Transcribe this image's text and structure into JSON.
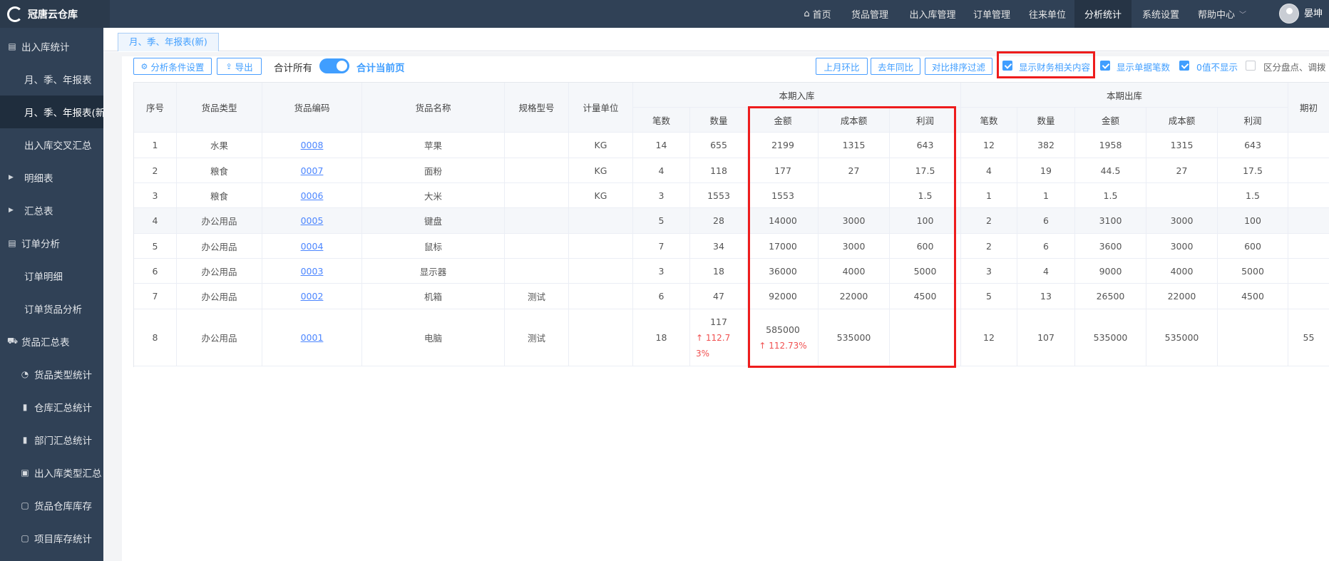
{
  "app": {
    "name": "冠唐云仓库",
    "user": "晏坤"
  },
  "nav": {
    "items": [
      {
        "label": "首页",
        "icon": "home-icon"
      },
      {
        "label": "货品管理"
      },
      {
        "label": "出入库管理"
      },
      {
        "label": "订单管理"
      },
      {
        "label": "往来单位"
      },
      {
        "label": "分析统计",
        "active": true
      },
      {
        "label": "系统设置"
      },
      {
        "label": "帮助中心",
        "dropdown": true
      }
    ]
  },
  "sidebar": {
    "items": [
      {
        "label": "出入库统计",
        "icon": "document-icon"
      },
      {
        "label": "月、季、年报表"
      },
      {
        "label": "月、季、年报表(新)",
        "active": true
      },
      {
        "label": "出入库交叉汇总"
      },
      {
        "label": "明细表",
        "icon": "caret-right-icon"
      },
      {
        "label": "汇总表",
        "icon": "caret-right-icon"
      },
      {
        "label": "订单分析",
        "icon": "document-icon"
      },
      {
        "label": "订单明细"
      },
      {
        "label": "订单货品分析"
      },
      {
        "label": "货品汇总表",
        "icon": "cart-icon"
      },
      {
        "label": "货品类型统计",
        "icon": "pie-chart-icon"
      },
      {
        "label": "仓库汇总统计",
        "icon": "bar-chart-icon"
      },
      {
        "label": "部门汇总统计",
        "icon": "bar-chart-icon"
      },
      {
        "label": "出入库类型汇总",
        "icon": "chart-icon"
      },
      {
        "label": "货品仓库库存",
        "icon": "box-icon"
      },
      {
        "label": "项目库存统计",
        "icon": "box-icon"
      }
    ]
  },
  "tabs": [
    {
      "label": "月、季、年报表(新)",
      "active": true
    }
  ],
  "toolbar": {
    "analysis_settings": "分析条件设置",
    "export": "导出",
    "total_all": "合计所有",
    "total_page": "合计当前页",
    "total_toggle_on": true,
    "prev_month": "上月环比",
    "last_year": "去年同比",
    "sort_filter": "对比排序过滤",
    "show_finance": "显示财务相关内容",
    "show_finance_checked": true,
    "show_doc_count": "显示单据笔数",
    "show_doc_count_checked": true,
    "hide_zero": "0值不显示",
    "hide_zero_checked": true,
    "split_stock": "区分盘点、调拨",
    "split_stock_checked": false
  },
  "table": {
    "group_headers": {
      "in": "本期入库",
      "out": "本期出库",
      "opening": "期初"
    },
    "columns": {
      "seq": "序号",
      "type": "货品类型",
      "code": "货品编码",
      "name": "货品名称",
      "spec": "规格型号",
      "unit": "计量单位",
      "count": "笔数",
      "qty": "数量",
      "amount": "金额",
      "cost": "成本额",
      "profit": "利润"
    },
    "rows": [
      {
        "seq": "1",
        "type": "水果",
        "code": "0008",
        "name": "苹果",
        "spec": "",
        "unit": "KG",
        "in_count": "14",
        "in_qty": "655",
        "in_amount": "2199",
        "in_cost": "1315",
        "in_profit": "643",
        "out_count": "12",
        "out_qty": "382",
        "out_amount": "1958",
        "out_cost": "1315",
        "out_profit": "643",
        "opening": ""
      },
      {
        "seq": "2",
        "type": "粮食",
        "code": "0007",
        "name": "面粉",
        "spec": "",
        "unit": "KG",
        "in_count": "4",
        "in_qty": "118",
        "in_amount": "177",
        "in_cost": "27",
        "in_profit": "17.5",
        "out_count": "4",
        "out_qty": "19",
        "out_amount": "44.5",
        "out_cost": "27",
        "out_profit": "17.5",
        "opening": ""
      },
      {
        "seq": "3",
        "type": "粮食",
        "code": "0006",
        "name": "大米",
        "spec": "",
        "unit": "KG",
        "in_count": "3",
        "in_qty": "1553",
        "in_amount": "1553",
        "in_cost": "",
        "in_profit": "1.5",
        "out_count": "1",
        "out_qty": "1",
        "out_amount": "1.5",
        "out_cost": "",
        "out_profit": "1.5",
        "opening": ""
      },
      {
        "seq": "4",
        "type": "办公用品",
        "code": "0005",
        "name": "键盘",
        "spec": "",
        "unit": "",
        "in_count": "5",
        "in_qty": "28",
        "in_amount": "14000",
        "in_cost": "3000",
        "in_profit": "100",
        "out_count": "2",
        "out_qty": "6",
        "out_amount": "3100",
        "out_cost": "3000",
        "out_profit": "100",
        "opening": "",
        "highlight": true
      },
      {
        "seq": "5",
        "type": "办公用品",
        "code": "0004",
        "name": "鼠标",
        "spec": "",
        "unit": "",
        "in_count": "7",
        "in_qty": "34",
        "in_amount": "17000",
        "in_cost": "3000",
        "in_profit": "600",
        "out_count": "2",
        "out_qty": "6",
        "out_amount": "3600",
        "out_cost": "3000",
        "out_profit": "600",
        "opening": ""
      },
      {
        "seq": "6",
        "type": "办公用品",
        "code": "0003",
        "name": "显示器",
        "spec": "",
        "unit": "",
        "in_count": "3",
        "in_qty": "18",
        "in_amount": "36000",
        "in_cost": "4000",
        "in_profit": "5000",
        "out_count": "3",
        "out_qty": "4",
        "out_amount": "9000",
        "out_cost": "4000",
        "out_profit": "5000",
        "opening": ""
      },
      {
        "seq": "7",
        "type": "办公用品",
        "code": "0002",
        "name": "机箱",
        "spec": "测试",
        "unit": "",
        "in_count": "6",
        "in_qty": "47",
        "in_amount": "92000",
        "in_cost": "22000",
        "in_profit": "4500",
        "out_count": "5",
        "out_qty": "13",
        "out_amount": "26500",
        "out_cost": "22000",
        "out_profit": "4500",
        "opening": ""
      },
      {
        "seq": "8",
        "type": "办公用品",
        "code": "0001",
        "name": "电脑",
        "spec": "测试",
        "unit": "",
        "in_count": "18",
        "in_qty": "117",
        "in_qty_change": "↑ 112.73%",
        "in_amount": "585000",
        "in_amount_change": "↑ 112.73%",
        "in_cost": "535000",
        "in_profit": "",
        "out_count": "12",
        "out_qty": "107",
        "out_amount": "535000",
        "out_cost": "535000",
        "out_profit": "",
        "opening": "55"
      }
    ]
  }
}
